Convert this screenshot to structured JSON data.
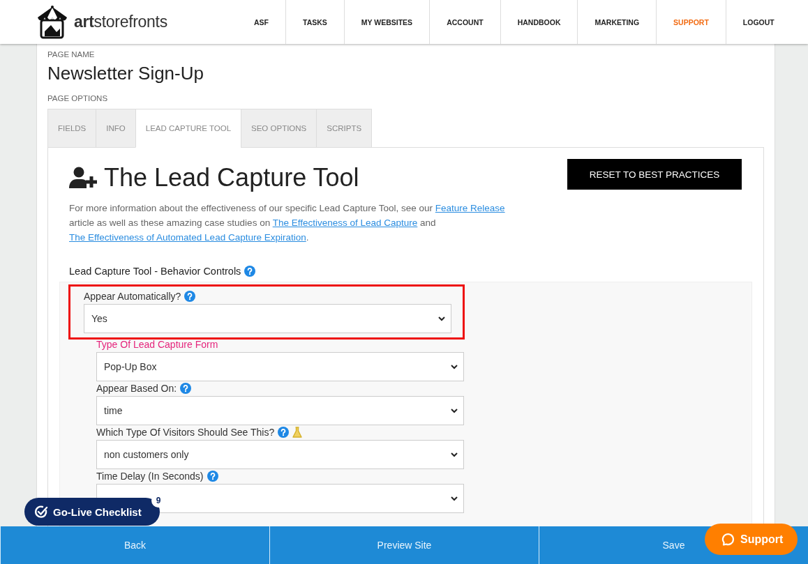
{
  "header": {
    "logo_text": "**art**storefronts",
    "nav": [
      {
        "label": "ASF",
        "selected": false
      },
      {
        "label": "TASKS",
        "selected": false
      },
      {
        "label": "MY WEBSITES",
        "selected": false
      },
      {
        "label": "ACCOUNT",
        "selected": false
      },
      {
        "label": "HANDBOOK",
        "selected": false
      },
      {
        "label": "MARKETING",
        "selected": false
      },
      {
        "label": "SUPPORT",
        "selected": true
      },
      {
        "label": "LOGOUT",
        "selected": false
      }
    ]
  },
  "page_name_label": "PAGE NAME",
  "page_name": "Newsletter Sign-Up",
  "page_options_label": "PAGE OPTIONS",
  "tabs": [
    {
      "label": "FIELDS",
      "selected": false
    },
    {
      "label": "INFO",
      "selected": false
    },
    {
      "label": "LEAD CAPTURE TOOL",
      "selected": true
    },
    {
      "label": "SEO OPTIONS",
      "selected": false
    },
    {
      "label": "SCRIPTS",
      "selected": false
    }
  ],
  "panel": {
    "title": "The Lead Capture Tool",
    "reset_button": "RESET TO BEST PRACTICES",
    "intro": [
      {
        "kind": "text",
        "text": "For more information about the effectiveness of our specific Lead Capture Tool, see our "
      },
      {
        "kind": "link",
        "text": "Feature Release"
      },
      {
        "kind": "text",
        "text": " article as well as these amazing case studies on "
      },
      {
        "kind": "link",
        "text": "The Effectiveness of Lead Capture"
      },
      {
        "kind": "text",
        "text": " and "
      },
      {
        "kind": "link",
        "text": "The Effectiveness of Automated Lead Capture Expiration"
      },
      {
        "kind": "text",
        "text": "."
      }
    ],
    "section_label": "Lead Capture Tool - Behavior Controls",
    "fields": [
      {
        "label": "Appear Automatically?",
        "help": true,
        "experimental": false,
        "accent": false,
        "highlighted": true,
        "value": "Yes"
      },
      {
        "label": "Type Of Lead Capture Form",
        "help": false,
        "experimental": false,
        "accent": true,
        "highlighted": false,
        "value": "Pop-Up Box"
      },
      {
        "label": "Appear Based On:",
        "help": true,
        "experimental": false,
        "accent": false,
        "highlighted": false,
        "value": "time"
      },
      {
        "label": "Which Type Of Visitors Should See This?",
        "help": true,
        "experimental": true,
        "accent": false,
        "highlighted": false,
        "value": "non customers only"
      },
      {
        "label": "Time Delay (In Seconds)",
        "help": true,
        "experimental": false,
        "accent": false,
        "highlighted": false
      }
    ]
  },
  "footer": {
    "buttons": [
      "Back",
      "Preview Site",
      "Save"
    ]
  },
  "checklist": {
    "label": "Go-Live Checklist",
    "count": "9"
  },
  "support": {
    "label": "Support"
  }
}
